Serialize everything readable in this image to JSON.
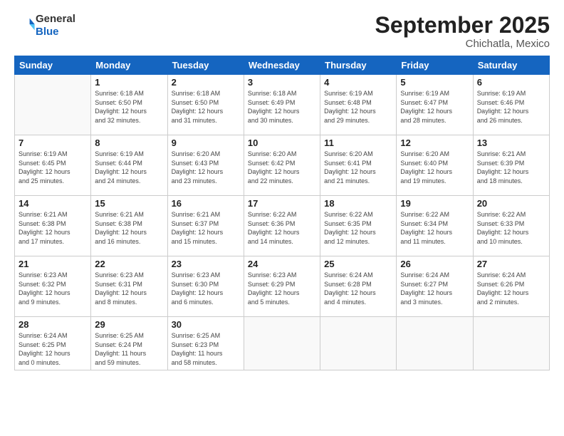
{
  "logo": {
    "text_general": "General",
    "text_blue": "Blue"
  },
  "header": {
    "month": "September 2025",
    "location": "Chichatla, Mexico"
  },
  "weekdays": [
    "Sunday",
    "Monday",
    "Tuesday",
    "Wednesday",
    "Thursday",
    "Friday",
    "Saturday"
  ],
  "weeks": [
    [
      {
        "day": "",
        "info": ""
      },
      {
        "day": "1",
        "info": "Sunrise: 6:18 AM\nSunset: 6:50 PM\nDaylight: 12 hours\nand 32 minutes."
      },
      {
        "day": "2",
        "info": "Sunrise: 6:18 AM\nSunset: 6:50 PM\nDaylight: 12 hours\nand 31 minutes."
      },
      {
        "day": "3",
        "info": "Sunrise: 6:18 AM\nSunset: 6:49 PM\nDaylight: 12 hours\nand 30 minutes."
      },
      {
        "day": "4",
        "info": "Sunrise: 6:19 AM\nSunset: 6:48 PM\nDaylight: 12 hours\nand 29 minutes."
      },
      {
        "day": "5",
        "info": "Sunrise: 6:19 AM\nSunset: 6:47 PM\nDaylight: 12 hours\nand 28 minutes."
      },
      {
        "day": "6",
        "info": "Sunrise: 6:19 AM\nSunset: 6:46 PM\nDaylight: 12 hours\nand 26 minutes."
      }
    ],
    [
      {
        "day": "7",
        "info": "Sunrise: 6:19 AM\nSunset: 6:45 PM\nDaylight: 12 hours\nand 25 minutes."
      },
      {
        "day": "8",
        "info": "Sunrise: 6:19 AM\nSunset: 6:44 PM\nDaylight: 12 hours\nand 24 minutes."
      },
      {
        "day": "9",
        "info": "Sunrise: 6:20 AM\nSunset: 6:43 PM\nDaylight: 12 hours\nand 23 minutes."
      },
      {
        "day": "10",
        "info": "Sunrise: 6:20 AM\nSunset: 6:42 PM\nDaylight: 12 hours\nand 22 minutes."
      },
      {
        "day": "11",
        "info": "Sunrise: 6:20 AM\nSunset: 6:41 PM\nDaylight: 12 hours\nand 21 minutes."
      },
      {
        "day": "12",
        "info": "Sunrise: 6:20 AM\nSunset: 6:40 PM\nDaylight: 12 hours\nand 19 minutes."
      },
      {
        "day": "13",
        "info": "Sunrise: 6:21 AM\nSunset: 6:39 PM\nDaylight: 12 hours\nand 18 minutes."
      }
    ],
    [
      {
        "day": "14",
        "info": "Sunrise: 6:21 AM\nSunset: 6:38 PM\nDaylight: 12 hours\nand 17 minutes."
      },
      {
        "day": "15",
        "info": "Sunrise: 6:21 AM\nSunset: 6:38 PM\nDaylight: 12 hours\nand 16 minutes."
      },
      {
        "day": "16",
        "info": "Sunrise: 6:21 AM\nSunset: 6:37 PM\nDaylight: 12 hours\nand 15 minutes."
      },
      {
        "day": "17",
        "info": "Sunrise: 6:22 AM\nSunset: 6:36 PM\nDaylight: 12 hours\nand 14 minutes."
      },
      {
        "day": "18",
        "info": "Sunrise: 6:22 AM\nSunset: 6:35 PM\nDaylight: 12 hours\nand 12 minutes."
      },
      {
        "day": "19",
        "info": "Sunrise: 6:22 AM\nSunset: 6:34 PM\nDaylight: 12 hours\nand 11 minutes."
      },
      {
        "day": "20",
        "info": "Sunrise: 6:22 AM\nSunset: 6:33 PM\nDaylight: 12 hours\nand 10 minutes."
      }
    ],
    [
      {
        "day": "21",
        "info": "Sunrise: 6:23 AM\nSunset: 6:32 PM\nDaylight: 12 hours\nand 9 minutes."
      },
      {
        "day": "22",
        "info": "Sunrise: 6:23 AM\nSunset: 6:31 PM\nDaylight: 12 hours\nand 8 minutes."
      },
      {
        "day": "23",
        "info": "Sunrise: 6:23 AM\nSunset: 6:30 PM\nDaylight: 12 hours\nand 6 minutes."
      },
      {
        "day": "24",
        "info": "Sunrise: 6:23 AM\nSunset: 6:29 PM\nDaylight: 12 hours\nand 5 minutes."
      },
      {
        "day": "25",
        "info": "Sunrise: 6:24 AM\nSunset: 6:28 PM\nDaylight: 12 hours\nand 4 minutes."
      },
      {
        "day": "26",
        "info": "Sunrise: 6:24 AM\nSunset: 6:27 PM\nDaylight: 12 hours\nand 3 minutes."
      },
      {
        "day": "27",
        "info": "Sunrise: 6:24 AM\nSunset: 6:26 PM\nDaylight: 12 hours\nand 2 minutes."
      }
    ],
    [
      {
        "day": "28",
        "info": "Sunrise: 6:24 AM\nSunset: 6:25 PM\nDaylight: 12 hours\nand 0 minutes."
      },
      {
        "day": "29",
        "info": "Sunrise: 6:25 AM\nSunset: 6:24 PM\nDaylight: 11 hours\nand 59 minutes."
      },
      {
        "day": "30",
        "info": "Sunrise: 6:25 AM\nSunset: 6:23 PM\nDaylight: 11 hours\nand 58 minutes."
      },
      {
        "day": "",
        "info": ""
      },
      {
        "day": "",
        "info": ""
      },
      {
        "day": "",
        "info": ""
      },
      {
        "day": "",
        "info": ""
      }
    ]
  ]
}
